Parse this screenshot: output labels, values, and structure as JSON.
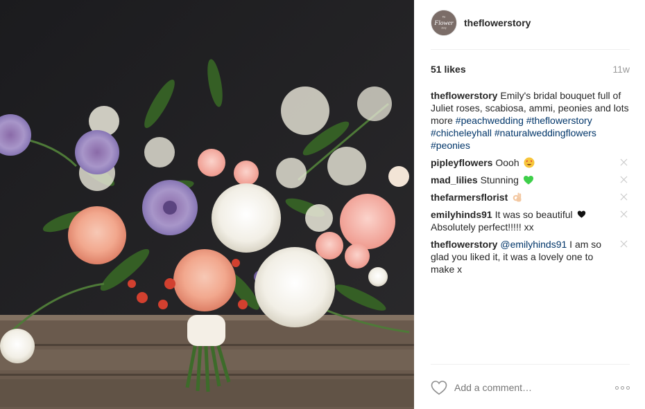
{
  "post": {
    "username": "theflowerstory",
    "avatar_text_top": "the",
    "avatar_text_main": "Flower",
    "avatar_text_bottom": "story",
    "likes": "51 likes",
    "time": "11w"
  },
  "caption": {
    "username": "theflowerstory",
    "text": "Emily's bridal bouquet full of Juliet roses, scabiosa, ammi, peonies and lots more",
    "hashtags": [
      "#peachwedding",
      "#theflowerstory",
      "#chicheleyhall",
      "#naturalweddingflowers",
      "#peonies"
    ]
  },
  "comments": [
    {
      "username": "pipleyflowers",
      "text": "Oooh",
      "emoji": "heart-eyes-emoji"
    },
    {
      "username": "mad_lilies",
      "text": "Stunning",
      "emoji": "green-heart-emoji"
    },
    {
      "username": "thefarmersflorist",
      "text": "",
      "emoji": "ok-hand-emoji"
    },
    {
      "username": "emilyhinds91",
      "text": "It was so beautiful",
      "emoji": "black-heart-emoji",
      "text2": "Absolutely perfect!!!!! xx"
    },
    {
      "username": "theflowerstory",
      "mention": "@emilyhinds91",
      "text": "I am so glad you liked it, it was a lovely one to make x"
    }
  ],
  "footer": {
    "placeholder": "Add a comment…",
    "like_icon": "heart-outline-icon",
    "more_icon": "more-options-icon"
  },
  "colors": {
    "link": "#003569",
    "muted": "#999999",
    "text": "#262626",
    "divider": "#efefef"
  }
}
